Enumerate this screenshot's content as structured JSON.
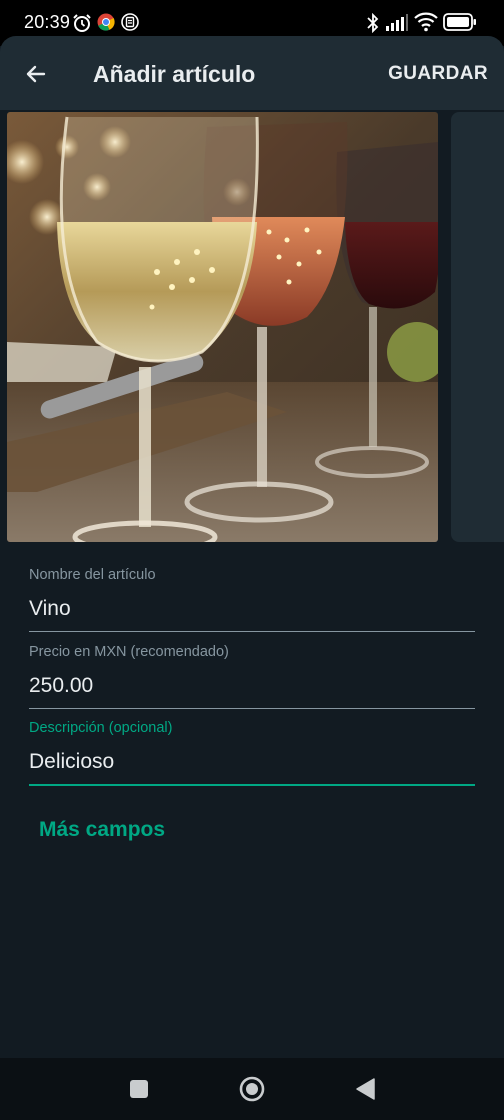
{
  "status_bar": {
    "time": "20:39",
    "icons": [
      "alarm-icon",
      "chrome-icon",
      "app-icon",
      "bluetooth-icon",
      "signal-icon",
      "wifi-icon",
      "battery-icon"
    ]
  },
  "header": {
    "title": "Añadir artículo",
    "save_label": "GUARDAR",
    "back_icon": "arrow-left-icon"
  },
  "gallery": {
    "images": [
      "wine-glasses-photo"
    ]
  },
  "form": {
    "name": {
      "label": "Nombre del artículo",
      "value": "Vino"
    },
    "price": {
      "label": "Precio en MXN (recomendado)",
      "value": "250.00"
    },
    "description": {
      "label": "Descripción (opcional)",
      "value": "Delicioso"
    }
  },
  "more_fields_label": "Más campos",
  "colors": {
    "accent": "#00a884",
    "background": "#121b22",
    "header": "#1f2c34",
    "text_primary": "#e9edef",
    "text_secondary": "#8696a0"
  },
  "nav_bar": {
    "buttons": [
      "recents-icon",
      "home-icon",
      "back-icon"
    ]
  }
}
